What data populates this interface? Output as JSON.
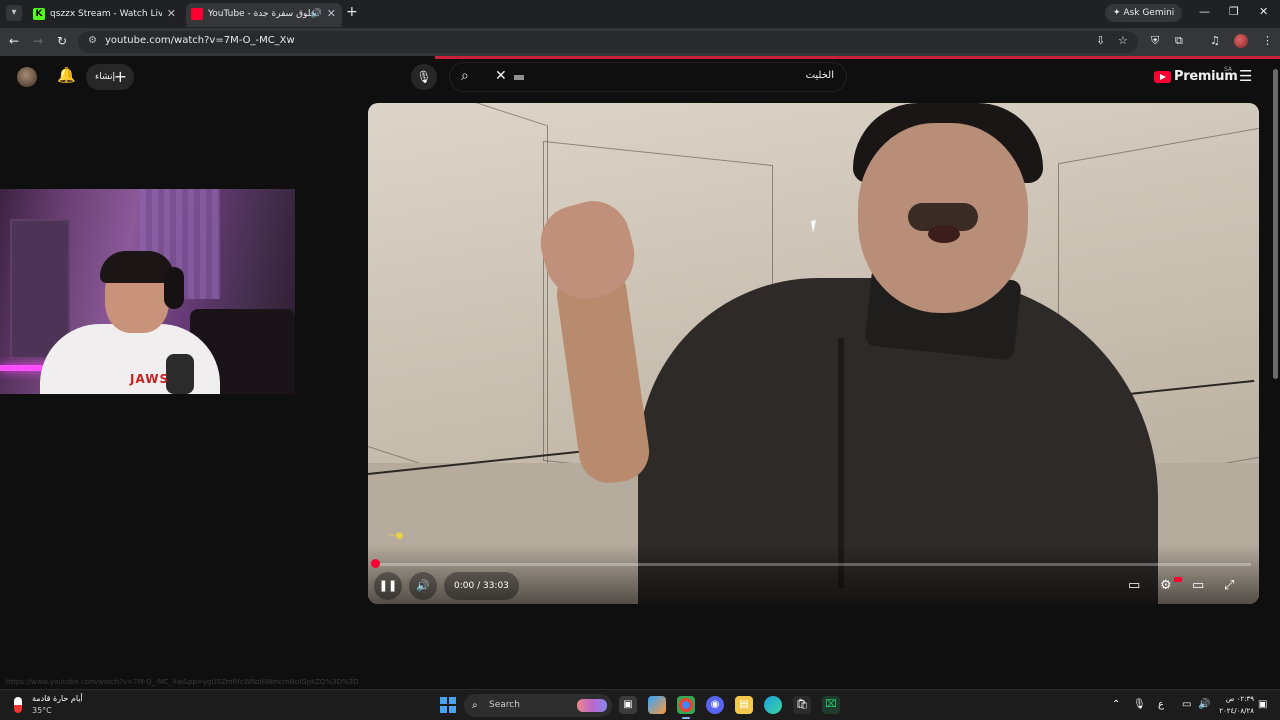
{
  "browser": {
    "tabs": [
      {
        "title": "qszzx Stream - Watch Live on K",
        "favicon": "kick-icon"
      },
      {
        "title": "YouTube - فلوق سفرة جدة",
        "favicon": "youtube-icon",
        "active": true
      }
    ],
    "new_tab": "+",
    "ask_gemini": "Ask Gemini",
    "url": "youtube.com/watch?v=7M-O_-MC_Xw"
  },
  "youtube": {
    "create_label": "إنشاء",
    "search_value": "الخليت",
    "logo_text": "Premium",
    "region": "SA"
  },
  "webcam": {
    "shirt_text": "JAWS"
  },
  "player": {
    "time": "0:00 / 33:03",
    "progress": 0.0,
    "state": "playing"
  },
  "status_bar_url": "https://www.youtube.com/watch?v=7M-O_-MC_Xw&pp=ygUSZmRfcWNzIHNmcmNoIGpkZQ%3D%3D",
  "taskbar": {
    "weather_text": "أيام حارة قادمة",
    "weather_temp": "35°C",
    "search_label": "Search",
    "lang": "ع",
    "time": "٠٢:٣٩ ص",
    "date": "٢٠٢٤/٠٨/٢٨"
  },
  "colors": {
    "accent": "#ff0033",
    "background": "#0f0f0f",
    "loading_bar": "#cc1f3d"
  }
}
